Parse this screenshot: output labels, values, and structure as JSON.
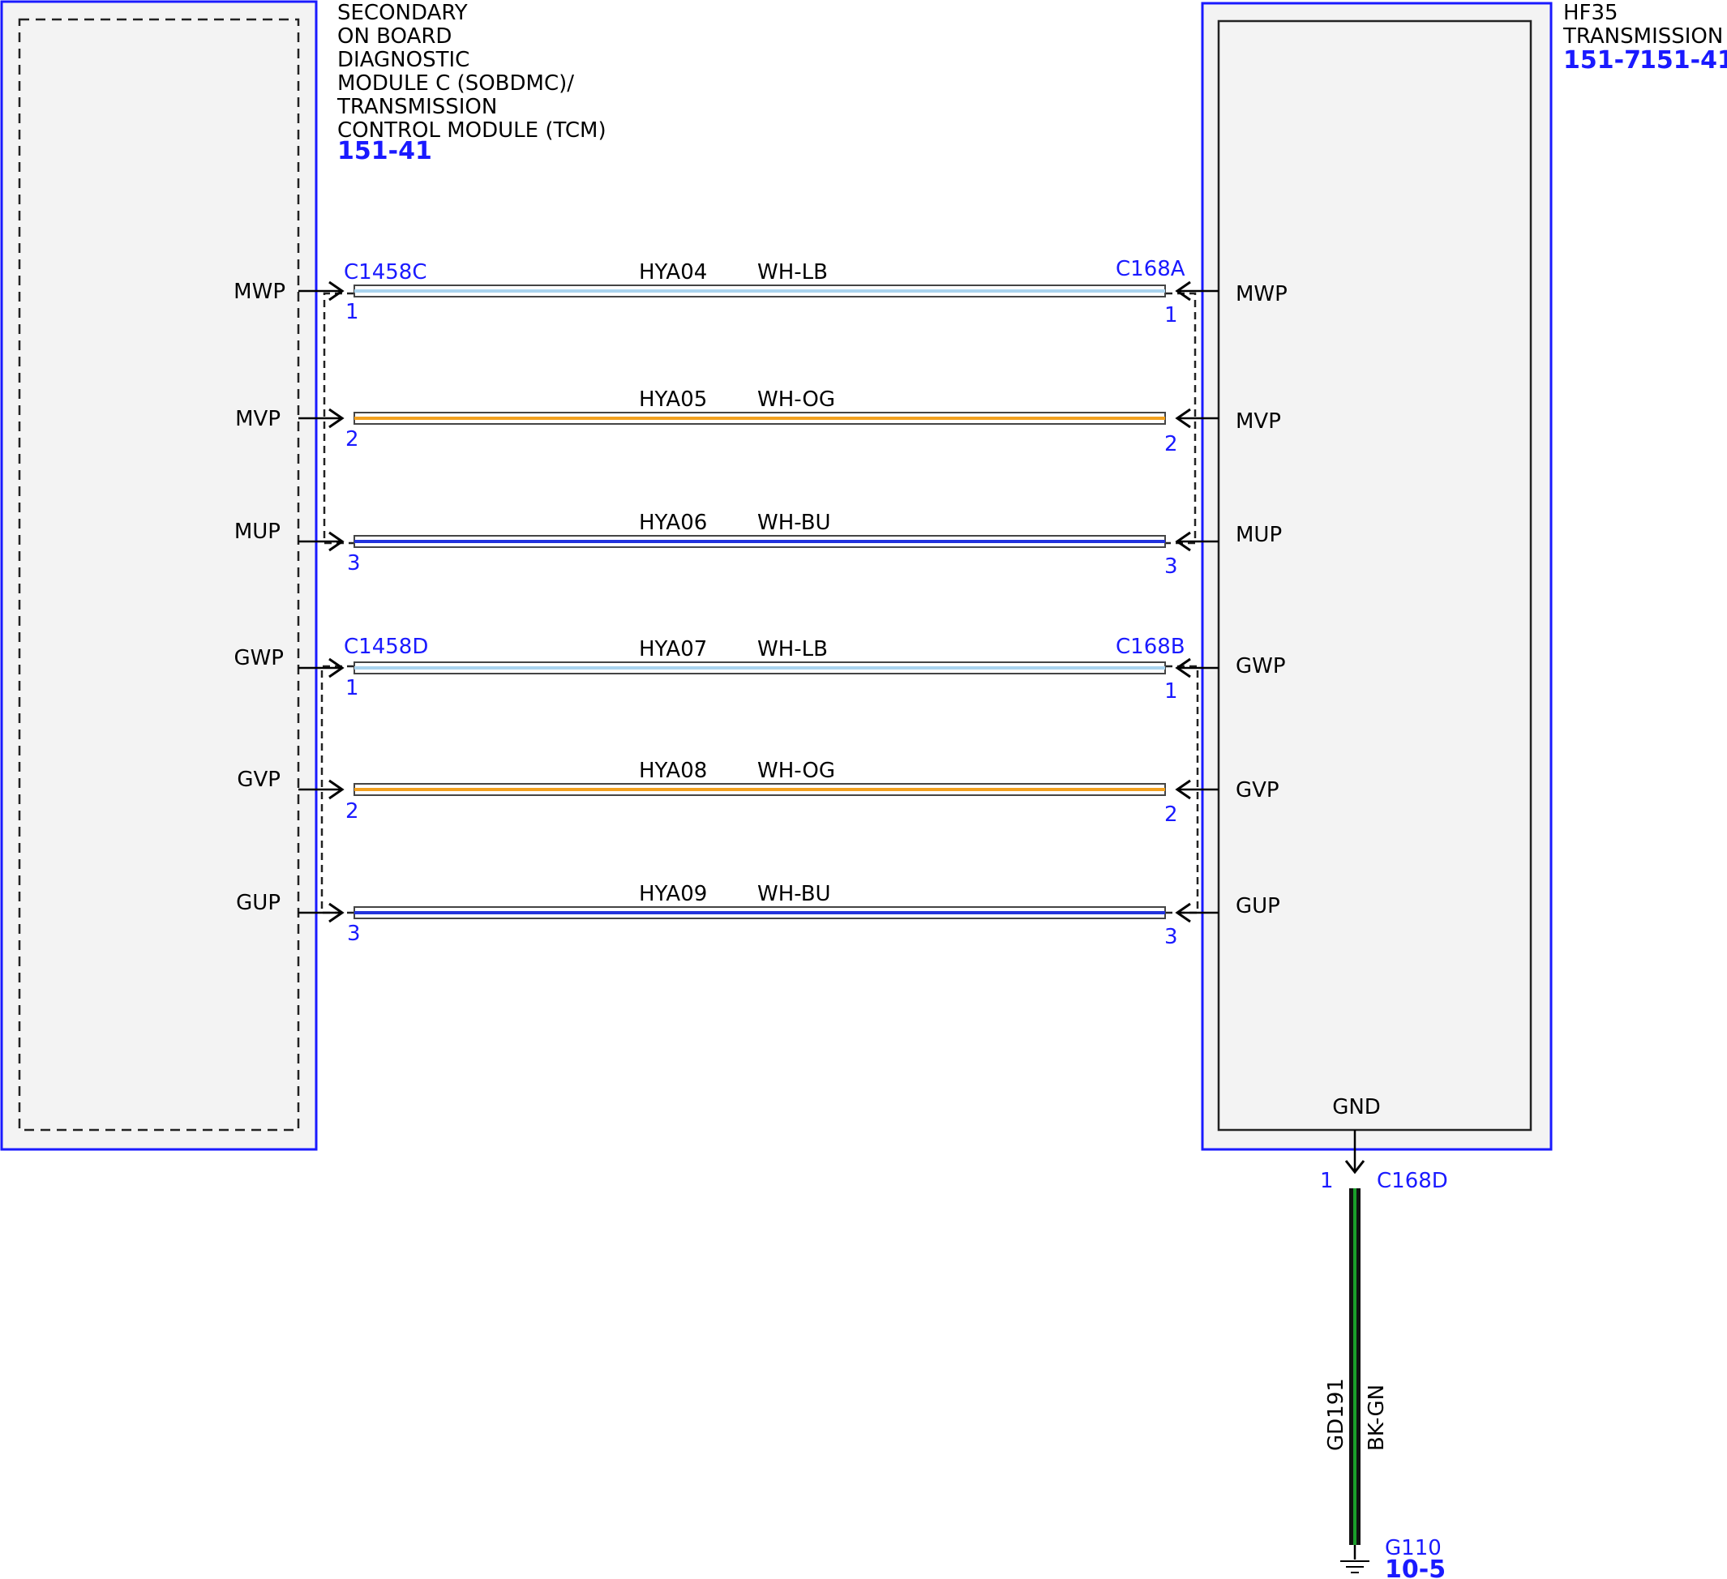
{
  "left_module": {
    "title_lines": [
      "SECONDARY",
      "ON BOARD",
      "DIAGNOSTIC",
      "MODULE C (SOBDMC)/",
      "TRANSMISSION",
      "CONTROL MODULE (TCM)"
    ],
    "ref": "151-41"
  },
  "right_module": {
    "title_lines": [
      "HF35",
      "TRANSMISSION"
    ],
    "refs": [
      "151-7",
      "151-41"
    ],
    "gnd_label": "GND"
  },
  "connectors": {
    "left_top": "C1458C",
    "left_bottom": "C1458D",
    "right_top": "C168A",
    "right_bottom": "C168B"
  },
  "wires": [
    {
      "signal_left": "MWP",
      "signal_right": "MWP",
      "circuit": "HYA04",
      "color_code": "WH-LB",
      "pin_left": "1",
      "pin_right": "1",
      "stripe": "#a9d3ee"
    },
    {
      "signal_left": "MVP",
      "signal_right": "MVP",
      "circuit": "HYA05",
      "color_code": "WH-OG",
      "pin_left": "2",
      "pin_right": "2",
      "stripe": "#f2a01e"
    },
    {
      "signal_left": "MUP",
      "signal_right": "MUP",
      "circuit": "HYA06",
      "color_code": "WH-BU",
      "pin_left": "3",
      "pin_right": "3",
      "stripe": "#2233dd"
    },
    {
      "signal_left": "GWP",
      "signal_right": "GWP",
      "circuit": "HYA07",
      "color_code": "WH-LB",
      "pin_left": "1",
      "pin_right": "1",
      "stripe": "#a9d3ee"
    },
    {
      "signal_left": "GVP",
      "signal_right": "GVP",
      "circuit": "HYA08",
      "color_code": "WH-OG",
      "pin_left": "2",
      "pin_right": "2",
      "stripe": "#f2a01e"
    },
    {
      "signal_left": "GUP",
      "signal_right": "GUP",
      "circuit": "HYA09",
      "color_code": "WH-BU",
      "pin_left": "3",
      "pin_right": "3",
      "stripe": "#2233dd"
    }
  ],
  "ground": {
    "pin": "1",
    "connector": "C168D",
    "circuit": "GD191",
    "color_code": "BK-GN",
    "stripe": "#1a9e2a",
    "point": "G110",
    "ref": "10-5"
  },
  "colors": {
    "accent_blue": "#1a1aff",
    "module_fill": "#f3f3f3",
    "wire_outline": "#444444"
  }
}
